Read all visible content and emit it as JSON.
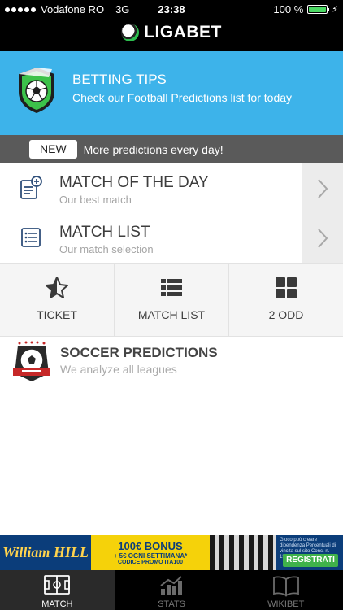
{
  "status_bar": {
    "carrier": "Vodafone RO",
    "network": "3G",
    "time": "23:38",
    "battery": "100 %",
    "battery_level": 1.0
  },
  "header": {
    "brand": "LIGABET"
  },
  "hero": {
    "title": "BETTING TIPS",
    "subtitle": "Check our Football Predictions list for today"
  },
  "news": {
    "badge": "NEW",
    "message": "More predictions every day!"
  },
  "rows": [
    {
      "title": "MATCH OF THE DAY",
      "subtitle": "Our best match",
      "icon": "document-plus-icon"
    },
    {
      "title": "MATCH LIST",
      "subtitle": "Our match selection",
      "icon": "list-icon"
    }
  ],
  "tiles": [
    {
      "label": "TICKET",
      "icon": "star-icon"
    },
    {
      "label": "MATCH LIST",
      "icon": "list-icon"
    },
    {
      "label": "2 ODD",
      "icon": "grid-icon"
    }
  ],
  "promo": {
    "title": "SOCCER PREDICTIONS",
    "subtitle": "We analyze all leagues"
  },
  "ad": {
    "brand": "William HILL",
    "bonus_line1": "100€ BONUS",
    "bonus_line2": "+ 5€ OGNI SETTIMANA*",
    "bonus_line3": "CODICE PROMO ITA100",
    "fine_print": "Gioco può creare dipendenza Percentuali di vincita sul sito Conc. n. 15226",
    "cta": "REGISTRATI"
  },
  "tabbar": [
    {
      "label": "MATCH",
      "icon": "pitch-icon",
      "active": true
    },
    {
      "label": "STATS",
      "icon": "stats-icon",
      "active": false
    },
    {
      "label": "WIKIBET",
      "icon": "book-icon",
      "active": false
    }
  ],
  "colors": {
    "header_bg": "#000000",
    "hero_bg": "#3db3ea",
    "news_bg": "#5a5a5a",
    "text_dark": "#3d3d3d",
    "text_muted": "#a5a5a5",
    "battery_green": "#4cd964",
    "ad_blue": "#0b3d7a",
    "ad_yellow": "#f5d20a"
  }
}
